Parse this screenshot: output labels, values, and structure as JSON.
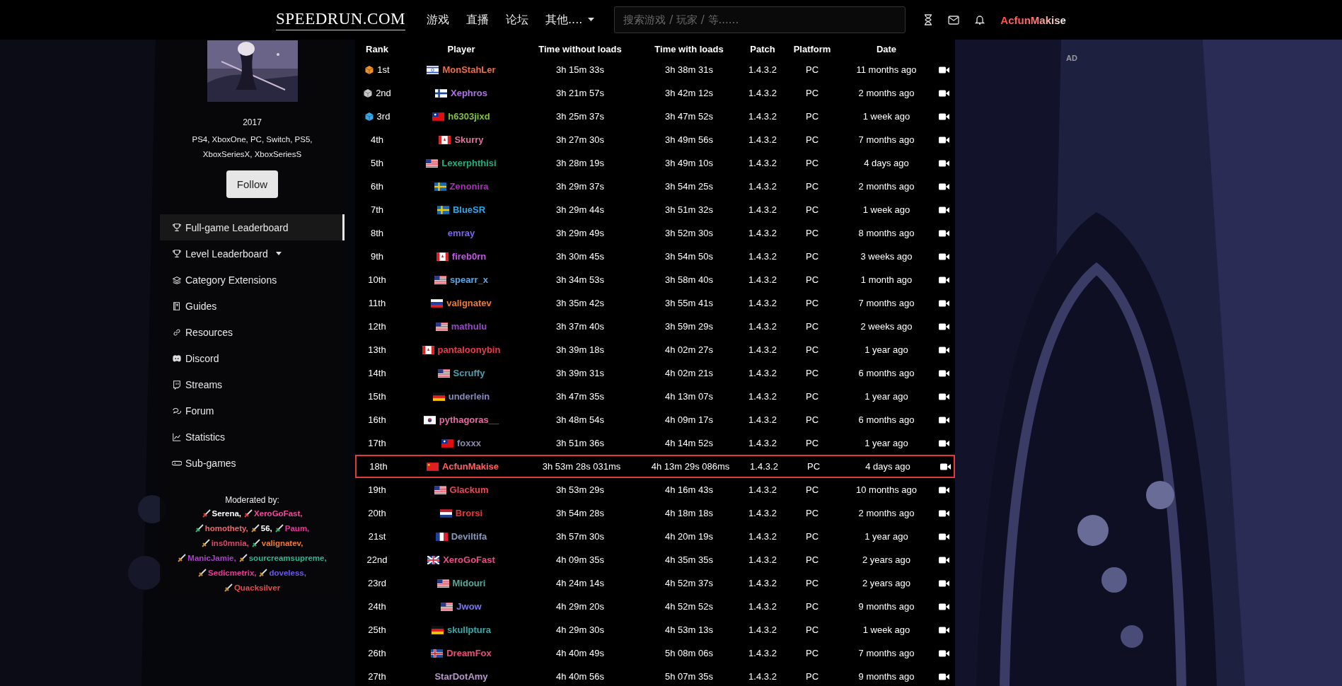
{
  "nav": {
    "logo": "SPEEDRUN.COM",
    "links": [
      {
        "label": "游戏",
        "dropdown": false
      },
      {
        "label": "直播",
        "dropdown": false
      },
      {
        "label": "论坛",
        "dropdown": false
      },
      {
        "label": "其他....",
        "dropdown": true
      }
    ],
    "search": {
      "placeholder": "搜索游戏 / 玩家 / 等......"
    },
    "user": "AcfunMakise"
  },
  "game": {
    "year": "2017",
    "platforms": "PS4, XboxOne, PC, Switch, PS5, XboxSeriesX, XboxSeriesS",
    "follow_button": "Follow"
  },
  "sidebar": {
    "items": [
      {
        "label": "Full-game Leaderboard",
        "selected": true,
        "dropdown": false
      },
      {
        "label": "Level Leaderboard",
        "selected": false,
        "dropdown": true
      },
      {
        "label": "Category Extensions",
        "selected": false,
        "dropdown": false
      },
      {
        "label": "Guides",
        "selected": false,
        "dropdown": false
      },
      {
        "label": "Resources",
        "selected": false,
        "dropdown": false
      },
      {
        "label": "Discord",
        "selected": false,
        "dropdown": false
      },
      {
        "label": "Streams",
        "selected": false,
        "dropdown": false
      },
      {
        "label": "Forum",
        "selected": false,
        "dropdown": false
      },
      {
        "label": "Statistics",
        "selected": false,
        "dropdown": false
      },
      {
        "label": "Sub-games",
        "selected": false,
        "dropdown": false
      }
    ],
    "moderators_title": "Moderated by:",
    "moderators": [
      {
        "name": "Serena,",
        "color": "#ffffff",
        "kind": "super"
      },
      {
        "name": "XeroGoFast,",
        "color": "#f04a9a",
        "kind": "super"
      },
      {
        "name": "homothety,",
        "color": "#e86a6a",
        "kind": "moderator"
      },
      {
        "name": "56,",
        "color": "#ffffff",
        "kind": "verifier"
      },
      {
        "name": "Paum,",
        "color": "#f0309a",
        "kind": "moderator"
      },
      {
        "name": "ins0mnia,",
        "color": "#d84a6a",
        "kind": "verifier"
      },
      {
        "name": "valignatev,",
        "color": "#f07a30",
        "kind": "moderator"
      },
      {
        "name": "ManicJamie,",
        "color": "#a840c8",
        "kind": "verifier"
      },
      {
        "name": "sourcreamsupreme,",
        "color": "#30b890",
        "kind": "verifier"
      },
      {
        "name": "Sedicmetrix,",
        "color": "#e83a98",
        "kind": "verifier"
      },
      {
        "name": "doveless,",
        "color": "#6a5ae8",
        "kind": "verifier"
      },
      {
        "name": "Quacksilver",
        "color": "#e84a4a",
        "kind": "verifier"
      }
    ]
  },
  "ad_label": "AD",
  "table": {
    "columns": [
      "Rank",
      "Player",
      "Time without loads",
      "Time with loads",
      "Patch",
      "Platform",
      "Date"
    ],
    "rows": [
      {
        "rank": "1st",
        "kind": "gold",
        "flag": {
          "kind": "il"
        },
        "player": "MonStahLer",
        "color": "#e8704c",
        "time_without_loads": "3h 15m 33s",
        "time_with_loads": "3h 38m 31s",
        "patch": "1.4.3.2",
        "platform": "PC",
        "date": "11 months ago",
        "highlighted": false
      },
      {
        "rank": "2nd",
        "kind": "silver",
        "flag": {
          "kind": "fi"
        },
        "player": "Xephros",
        "color": "#b070e8",
        "time_without_loads": "3h 21m 57s",
        "time_with_loads": "3h 42m 12s",
        "patch": "1.4.3.2",
        "platform": "PC",
        "date": "2 months ago",
        "highlighted": false
      },
      {
        "rank": "3rd",
        "kind": "bronze",
        "flag": {
          "kind": "tw"
        },
        "player": "h6303jixd",
        "color": "#80c040",
        "time_without_loads": "3h 25m 37s",
        "time_with_loads": "3h 47m 52s",
        "patch": "1.4.3.2",
        "platform": "PC",
        "date": "1 week ago",
        "highlighted": false
      },
      {
        "rank": "4th",
        "kind": "plain",
        "flag": {
          "kind": "ca"
        },
        "player": "Skurry",
        "color": "#e070a0",
        "time_without_loads": "3h 27m 30s",
        "time_with_loads": "3h 49m 56s",
        "patch": "1.4.3.2",
        "platform": "PC",
        "date": "7 months ago",
        "highlighted": false
      },
      {
        "rank": "5th",
        "kind": "plain",
        "flag": {
          "kind": "us"
        },
        "player": "Lexerphthisi",
        "color": "#20b080",
        "time_without_loads": "3h 28m 19s",
        "time_with_loads": "3h 49m 10s",
        "patch": "1.4.3.2",
        "platform": "PC",
        "date": "4 days ago",
        "highlighted": false
      },
      {
        "rank": "6th",
        "kind": "plain",
        "flag": {
          "kind": "se"
        },
        "player": "Zenonira",
        "color": "#a830b8",
        "time_without_loads": "3h 29m 37s",
        "time_with_loads": "3h 54m 25s",
        "patch": "1.4.3.2",
        "platform": "PC",
        "date": "2 months ago",
        "highlighted": false
      },
      {
        "rank": "7th",
        "kind": "plain",
        "flag": {
          "kind": "se"
        },
        "player": "BlueSR",
        "color": "#30a8e8",
        "time_without_loads": "3h 29m 44s",
        "time_with_loads": "3h 51m 32s",
        "patch": "1.4.3.2",
        "platform": "PC",
        "date": "1 week ago",
        "highlighted": false
      },
      {
        "rank": "8th",
        "kind": "plain",
        "player": "emray",
        "color": "#7a64e8",
        "time_without_loads": "3h 29m 49s",
        "time_with_loads": "3h 52m 30s",
        "patch": "1.4.3.2",
        "platform": "PC",
        "date": "8 months ago",
        "highlighted": false
      },
      {
        "rank": "9th",
        "kind": "plain",
        "flag": {
          "kind": "ca"
        },
        "player": "fireb0rn",
        "color": "#c058e0",
        "time_without_loads": "3h 30m 45s",
        "time_with_loads": "3h 54m 50s",
        "patch": "1.4.3.2",
        "platform": "PC",
        "date": "3 weeks ago",
        "highlighted": false
      },
      {
        "rank": "10th",
        "kind": "plain",
        "flag": {
          "kind": "us"
        },
        "player": "spearr_x",
        "color": "#58a8e8",
        "time_without_loads": "3h 34m 53s",
        "time_with_loads": "3h 58m 40s",
        "patch": "1.4.3.2",
        "platform": "PC",
        "date": "1 month ago",
        "highlighted": false
      },
      {
        "rank": "11th",
        "kind": "plain",
        "flag": {
          "kind": "ru"
        },
        "player": "valignatev",
        "color": "#f07a30",
        "time_without_loads": "3h 35m 42s",
        "time_with_loads": "3h 55m 41s",
        "patch": "1.4.3.2",
        "platform": "PC",
        "date": "7 months ago",
        "highlighted": false
      },
      {
        "rank": "12th",
        "kind": "plain",
        "flag": {
          "kind": "us"
        },
        "player": "mathulu",
        "color": "#9848c8",
        "time_without_loads": "3h 37m 40s",
        "time_with_loads": "3h 59m 29s",
        "patch": "1.4.3.2",
        "platform": "PC",
        "date": "2 weeks ago",
        "highlighted": false
      },
      {
        "rank": "13th",
        "kind": "plain",
        "flag": {
          "kind": "ca"
        },
        "player": "pantaloonybin",
        "color": "#f03a4a",
        "time_without_loads": "3h 39m 18s",
        "time_with_loads": "4h 02m 27s",
        "patch": "1.4.3.2",
        "platform": "PC",
        "date": "1 year ago",
        "highlighted": false
      },
      {
        "rank": "14th",
        "kind": "plain",
        "flag": {
          "kind": "us"
        },
        "player": "Scruffy",
        "color": "#4aa0b0",
        "time_without_loads": "3h 39m 31s",
        "time_with_loads": "4h 02m 21s",
        "patch": "1.4.3.2",
        "platform": "PC",
        "date": "6 months ago",
        "highlighted": false
      },
      {
        "rank": "15th",
        "kind": "plain",
        "flag": {
          "kind": "de"
        },
        "player": "underlein",
        "color": "#8a8ac0",
        "time_without_loads": "3h 47m 35s",
        "time_with_loads": "4h 13m 07s",
        "patch": "1.4.3.2",
        "platform": "PC",
        "date": "1 year ago",
        "highlighted": false
      },
      {
        "rank": "16th",
        "kind": "plain",
        "flag": {
          "kind": "kr"
        },
        "player": "pythagoras__",
        "color": "#e868a0",
        "time_without_loads": "3h 48m 54s",
        "time_with_loads": "4h 09m 17s",
        "patch": "1.4.3.2",
        "platform": "PC",
        "date": "6 months ago",
        "highlighted": false
      },
      {
        "rank": "17th",
        "kind": "plain",
        "flag": {
          "kind": "tw"
        },
        "player": "foxxx",
        "color": "#8a8aa8",
        "time_without_loads": "3h 51m 36s",
        "time_with_loads": "4h 14m 52s",
        "patch": "1.4.3.2",
        "platform": "PC",
        "date": "1 year ago",
        "highlighted": false
      },
      {
        "rank": "18th",
        "kind": "plain",
        "flag": {
          "kind": "cn"
        },
        "player": "AcfunMakise",
        "color": "#ff6060",
        "time_without_loads": "3h 53m 28s 031ms",
        "time_with_loads": "4h 13m 29s 086ms",
        "patch": "1.4.3.2",
        "platform": "PC",
        "date": "4 days ago",
        "highlighted": true
      },
      {
        "rank": "19th",
        "kind": "plain",
        "flag": {
          "kind": "us"
        },
        "player": "Glackum",
        "color": "#e84858",
        "time_without_loads": "3h 53m 29s",
        "time_with_loads": "4h 16m 43s",
        "patch": "1.4.3.2",
        "platform": "PC",
        "date": "10 months ago",
        "highlighted": false
      },
      {
        "rank": "20th",
        "kind": "plain",
        "flag": {
          "kind": "nl"
        },
        "player": "Brorsi",
        "color": "#f03434",
        "time_without_loads": "3h 54m 28s",
        "time_with_loads": "4h 18m 18s",
        "patch": "1.4.3.2",
        "platform": "PC",
        "date": "2 months ago",
        "highlighted": false
      },
      {
        "rank": "21st",
        "kind": "plain",
        "flag": {
          "kind": "fr"
        },
        "player": "Deviltifa",
        "color": "#8898b8",
        "time_without_loads": "3h 57m 30s",
        "time_with_loads": "4h 20m 19s",
        "patch": "1.4.3.2",
        "platform": "PC",
        "date": "1 year ago",
        "highlighted": false
      },
      {
        "rank": "22nd",
        "kind": "plain",
        "flag": {
          "kind": "gb"
        },
        "player": "XeroGoFast",
        "color": "#f04a8a",
        "time_without_loads": "4h 09m 35s",
        "time_with_loads": "4h 35m 35s",
        "patch": "1.4.3.2",
        "platform": "PC",
        "date": "2 years ago",
        "highlighted": false
      },
      {
        "rank": "23rd",
        "kind": "plain",
        "flag": {
          "kind": "us"
        },
        "player": "Midouri",
        "color": "#58a898",
        "time_without_loads": "4h 24m 14s",
        "time_with_loads": "4h 52m 37s",
        "patch": "1.4.3.2",
        "platform": "PC",
        "date": "2 years ago",
        "highlighted": false
      },
      {
        "rank": "24th",
        "kind": "plain",
        "flag": {
          "kind": "us"
        },
        "player": "Jwow",
        "color": "#7a78e8",
        "time_without_loads": "4h 29m 20s",
        "time_with_loads": "4h 52m 52s",
        "patch": "1.4.3.2",
        "platform": "PC",
        "date": "9 months ago",
        "highlighted": false
      },
      {
        "rank": "25th",
        "kind": "plain",
        "flag": {
          "kind": "de"
        },
        "player": "skullptura",
        "color": "#38a8a8",
        "time_without_loads": "4h 29m 30s",
        "time_with_loads": "4h 53m 13s",
        "patch": "1.4.3.2",
        "platform": "PC",
        "date": "1 week ago",
        "highlighted": false
      },
      {
        "rank": "26th",
        "kind": "plain",
        "flag": {
          "kind": "is"
        },
        "player": "DreamFox",
        "color": "#f04a78",
        "time_without_loads": "4h 40m 49s",
        "time_with_loads": "5h 08m 06s",
        "patch": "1.4.3.2",
        "platform": "PC",
        "date": "7 months ago",
        "highlighted": false
      },
      {
        "rank": "27th",
        "kind": "plain",
        "player": "StarDotAmy",
        "color": "#b898c8",
        "time_without_loads": "4h 40m 56s",
        "time_with_loads": "5h 07m 35s",
        "patch": "1.4.3.2",
        "platform": "PC",
        "date": "9 months ago",
        "highlighted": false
      }
    ]
  }
}
